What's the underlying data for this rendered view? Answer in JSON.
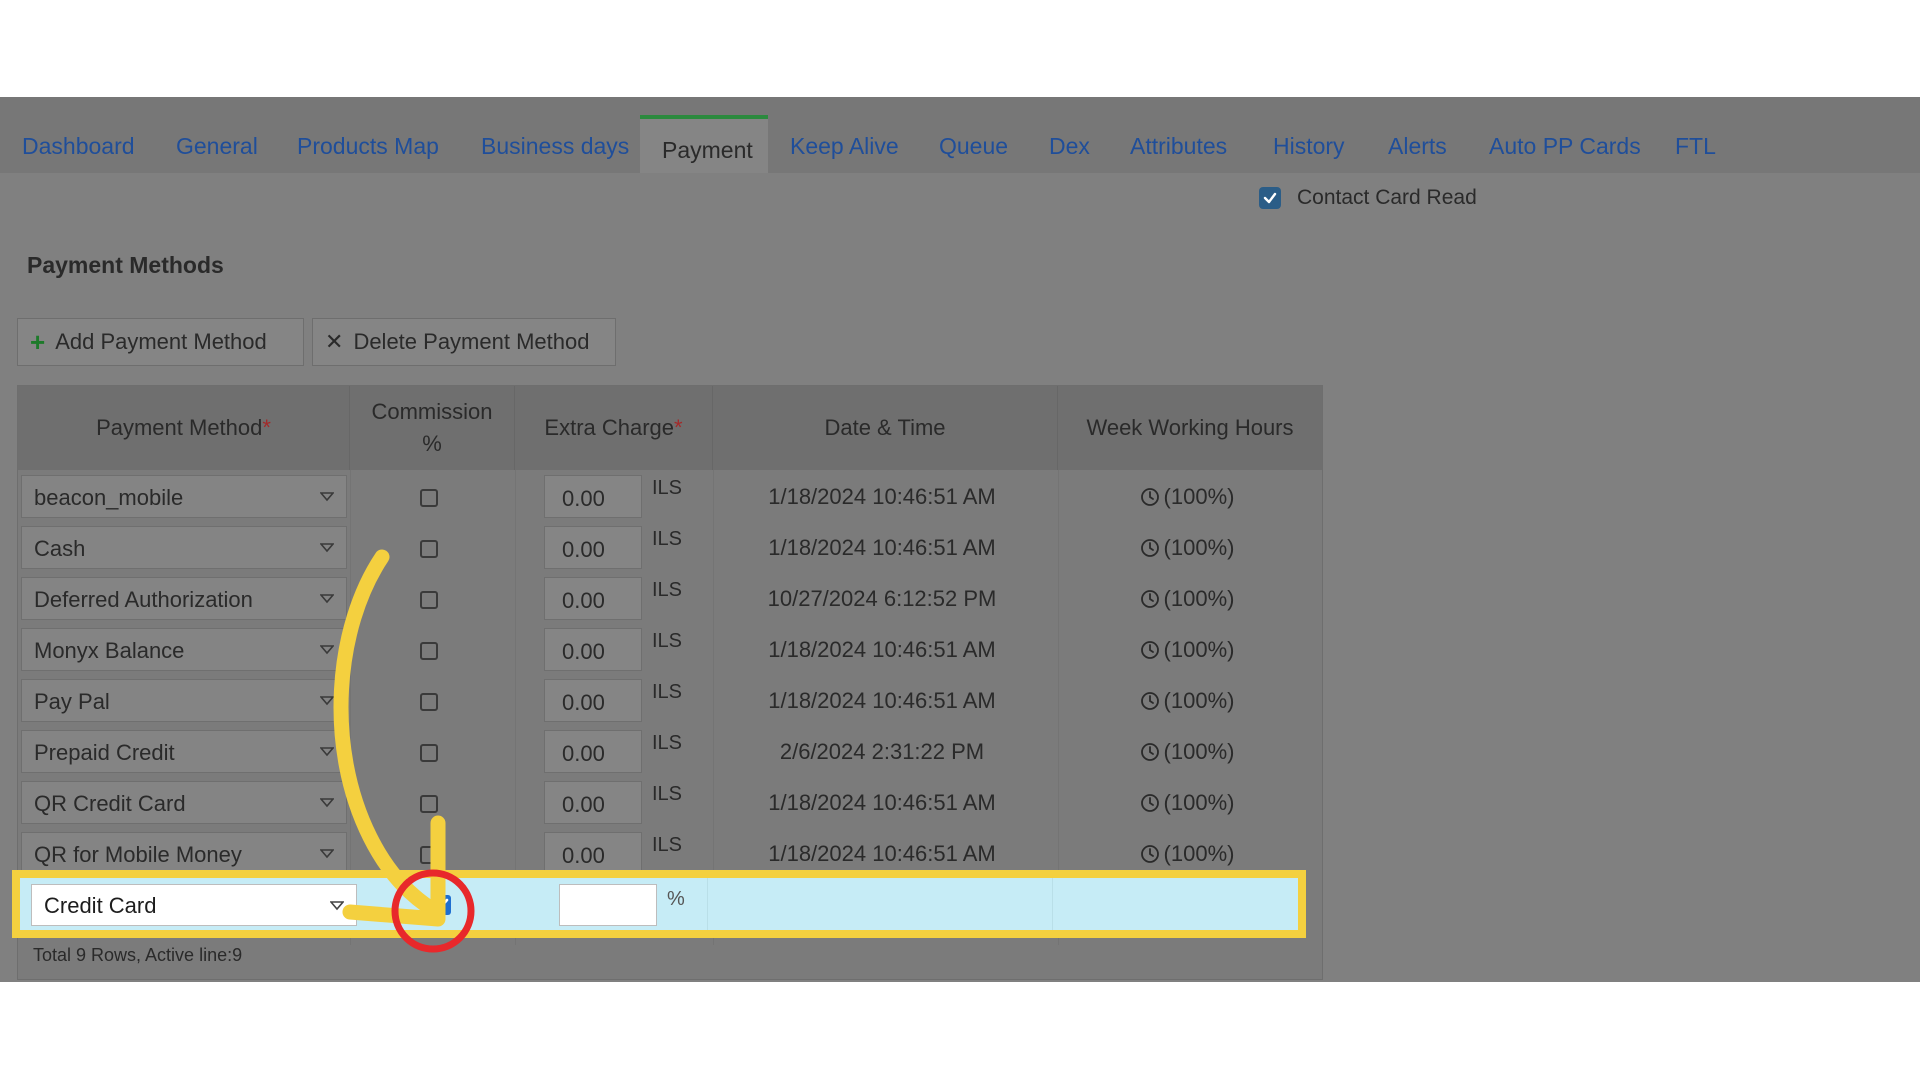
{
  "tabs": [
    {
      "label": "Dashboard"
    },
    {
      "label": "General"
    },
    {
      "label": "Products Map"
    },
    {
      "label": "Business days"
    },
    {
      "label": "Payment"
    },
    {
      "label": "Keep Alive"
    },
    {
      "label": "Queue"
    },
    {
      "label": "Dex"
    },
    {
      "label": "Attributes"
    },
    {
      "label": "History"
    },
    {
      "label": "Alerts"
    },
    {
      "label": "Auto PP Cards"
    },
    {
      "label": "FTL"
    }
  ],
  "active_tab": "Payment",
  "contact_card_read": {
    "label": "Contact Card Read",
    "checked": true
  },
  "section_title": "Payment Methods",
  "toolbar": {
    "add_label": "Add Payment Method",
    "delete_label": "Delete Payment Method"
  },
  "grid": {
    "headers": {
      "payment_method": "Payment Method",
      "commission_line1": "Commission",
      "commission_line2": "%",
      "extra_charge": "Extra Charge",
      "date_time": "Date & Time",
      "week_hours": "Week Working Hours",
      "required_mark": "*"
    },
    "rows": [
      {
        "method": "beacon_mobile",
        "commission": false,
        "extra": "0.00",
        "currency": "ILS",
        "datetime": "1/18/2024 10:46:51 AM",
        "hours": "(100%)"
      },
      {
        "method": "Cash",
        "commission": false,
        "extra": "0.00",
        "currency": "ILS",
        "datetime": "1/18/2024 10:46:51 AM",
        "hours": "(100%)"
      },
      {
        "method": "Deferred Authorization",
        "commission": false,
        "extra": "0.00",
        "currency": "ILS",
        "datetime": "10/27/2024 6:12:52 PM",
        "hours": "(100%)"
      },
      {
        "method": "Monyx Balance",
        "commission": false,
        "extra": "0.00",
        "currency": "ILS",
        "datetime": "1/18/2024 10:46:51 AM",
        "hours": "(100%)"
      },
      {
        "method": "Pay Pal",
        "commission": false,
        "extra": "0.00",
        "currency": "ILS",
        "datetime": "1/18/2024 10:46:51 AM",
        "hours": "(100%)"
      },
      {
        "method": "Prepaid Credit",
        "commission": false,
        "extra": "0.00",
        "currency": "ILS",
        "datetime": "2/6/2024 2:31:22 PM",
        "hours": "(100%)"
      },
      {
        "method": "QR Credit Card",
        "commission": false,
        "extra": "0.00",
        "currency": "ILS",
        "datetime": "1/18/2024 10:46:51 AM",
        "hours": "(100%)"
      },
      {
        "method": "QR for Mobile Money",
        "commission": false,
        "extra": "0.00",
        "currency": "ILS",
        "datetime": "1/18/2024 10:46:51 AM",
        "hours": "(100%)"
      }
    ],
    "active_row": {
      "method": "Credit Card",
      "commission": true,
      "extra": "",
      "unit": "%"
    },
    "footer": "Total 9 Rows, Active line:9"
  },
  "colors": {
    "tab_text": "#1f4e9a",
    "active_tab_border": "#2b8a3e",
    "highlight_border": "#f4d03f",
    "active_row_bg": "#c6ecf6",
    "arrow": "#f4d03f",
    "circle": "#e8282b",
    "checkbox_blue": "#1f6fd1"
  },
  "icons": {
    "add": "plus-icon",
    "delete": "close-icon",
    "dropdown": "chevron-down-icon",
    "hours": "clock-icon"
  }
}
